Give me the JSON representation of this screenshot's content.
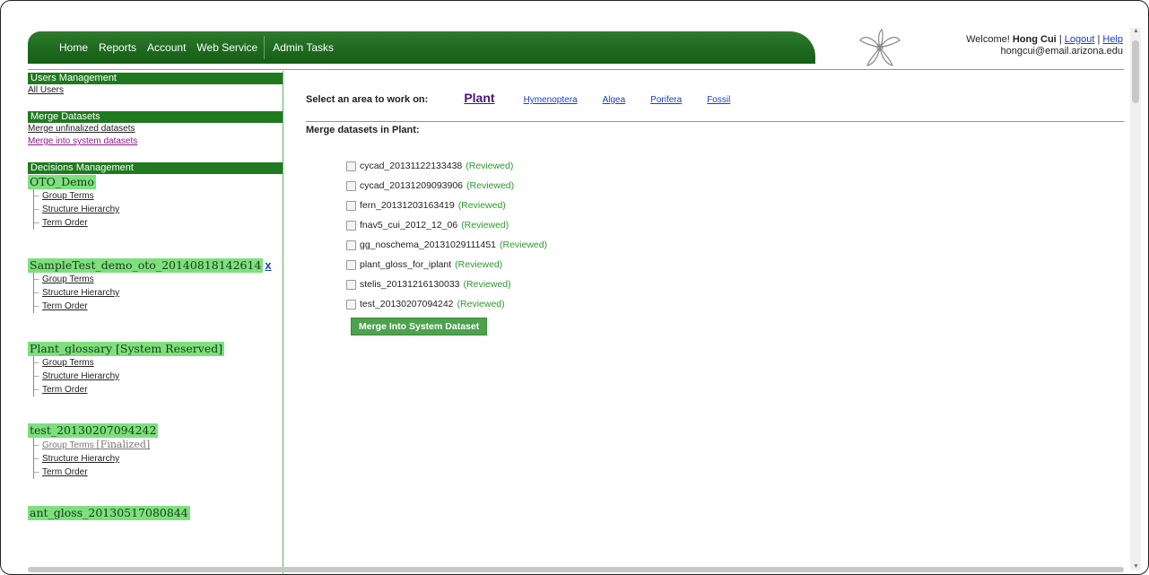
{
  "nav": {
    "items": [
      "Home",
      "Reports",
      "Account",
      "Web Service",
      "Admin Tasks"
    ]
  },
  "header": {
    "welcome_prefix": "Welcome!",
    "user_name": "Hong Cui",
    "logout": "Logout",
    "help": "Help",
    "email": "hongcui@email.arizona.edu",
    "sep": "|"
  },
  "sidebar": {
    "users_head": "Users Management",
    "all_users": "All Users",
    "merge_head": "Merge Datasets",
    "merge_unfinalized": "Merge unfinalized datasets",
    "merge_system": "Merge into system datasets",
    "decisions_head": "Decisions Management",
    "projects": [
      {
        "name": "OTO_Demo",
        "links": [
          "Group Terms",
          "Structure Hierarchy",
          "Term Order"
        ]
      },
      {
        "name": "SampleTest_demo_oto_20140818142614",
        "delete": "x",
        "links": [
          "Group Terms",
          "Structure Hierarchy",
          "Term Order"
        ]
      },
      {
        "name": "Plant_glossary [System Reserved]",
        "links": [
          "Group Terms",
          "Structure Hierarchy",
          "Term Order"
        ]
      },
      {
        "name": "test_20130207094242",
        "finalized_note": "[Finalized]",
        "links": [
          "Group Terms",
          "Structure Hierarchy",
          "Term Order"
        ]
      },
      {
        "name": "ant_gloss_20130517080844"
      }
    ]
  },
  "main": {
    "select_label": "Select an area to work on:",
    "areas": [
      "Plant",
      "Hymenoptera",
      "Algea",
      "Porifera",
      "Fossil"
    ],
    "merge_title": "Merge datasets in Plant:",
    "datasets": [
      {
        "name": "cycad_20131122133438",
        "status": "(Reviewed)"
      },
      {
        "name": "cycad_20131209093906",
        "status": "(Reviewed)"
      },
      {
        "name": "fern_20131203163419",
        "status": "(Reviewed)"
      },
      {
        "name": "fnav5_cui_2012_12_06",
        "status": "(Reviewed)"
      },
      {
        "name": "gg_noschema_20131029111451",
        "status": "(Reviewed)"
      },
      {
        "name": "plant_gloss_for_iplant",
        "status": "(Reviewed)"
      },
      {
        "name": "stelis_20131216130033",
        "status": "(Reviewed)"
      },
      {
        "name": "test_20130207094242",
        "status": "(Reviewed)"
      }
    ],
    "merge_button": "Merge Into System Dataset"
  },
  "colors": {
    "nav_green": "#1e6a1e",
    "section_green": "#1f7a1f",
    "project_highlight": "#7de07d",
    "reviewed_green": "#2e9a2e",
    "link_blue": "#1a3fbf"
  }
}
